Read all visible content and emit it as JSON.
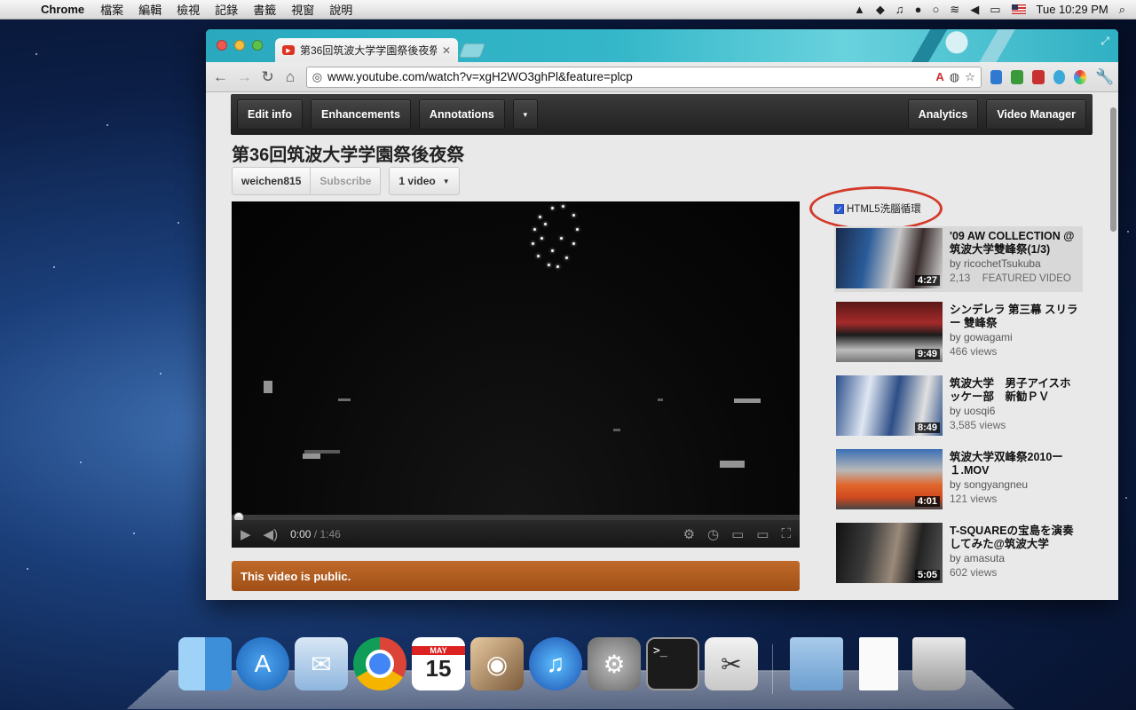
{
  "menubar": {
    "app_name": "Chrome",
    "menus": [
      "檔案",
      "編輯",
      "檢視",
      "記錄",
      "書籤",
      "視窗",
      "說明"
    ],
    "clock": "Tue 10:29 PM"
  },
  "browser": {
    "tab_title": "第36回筑波大学学園祭後夜祭",
    "url": "www.youtube.com/watch?v=xgH2WO3ghPl&feature=plcp"
  },
  "owner_bar": {
    "edit_info": "Edit info",
    "enhancements": "Enhancements",
    "annotations": "Annotations",
    "more": "▾",
    "analytics": "Analytics",
    "video_manager": "Video Manager"
  },
  "video": {
    "title": "第36回筑波大学学園祭後夜祭",
    "channel": "weichen815",
    "subscribe": "Subscribe",
    "video_count": "1 video",
    "current_time": "0:00",
    "duration": "/ 1:46",
    "public_notice": "This video is public."
  },
  "sidebar": {
    "html5_loop_label": "HTML5洗腦循環",
    "html5_loop_checked": true,
    "featured_label": "FEATURED VIDEO",
    "related": [
      {
        "title": "'09 AW COLLECTION @ 筑波大学雙峰祭(1/3)",
        "by": "by ricochetTsukuba",
        "views": "2,13",
        "duration": "4:27",
        "featured": true
      },
      {
        "title": "シンデレラ 第三幕 スリラー 雙峰祭",
        "by": "by gowagami",
        "views": "466 views",
        "duration": "9:49"
      },
      {
        "title": "筑波大学　男子アイスホッケー部　新勧ＰＶ",
        "by": "by uosqi6",
        "views": "3,585 views",
        "duration": "8:49"
      },
      {
        "title": "筑波大学双峰祭2010ー１.MOV",
        "by": "by songyangneu",
        "views": "121 views",
        "duration": "4:01"
      },
      {
        "title": "T-SQUAREの宝島を演奏してみた@筑波大学",
        "by": "by amasuta",
        "views": "602 views",
        "duration": "5:05"
      }
    ]
  },
  "dock": {
    "calendar_month": "MAY",
    "calendar_day": "15"
  }
}
